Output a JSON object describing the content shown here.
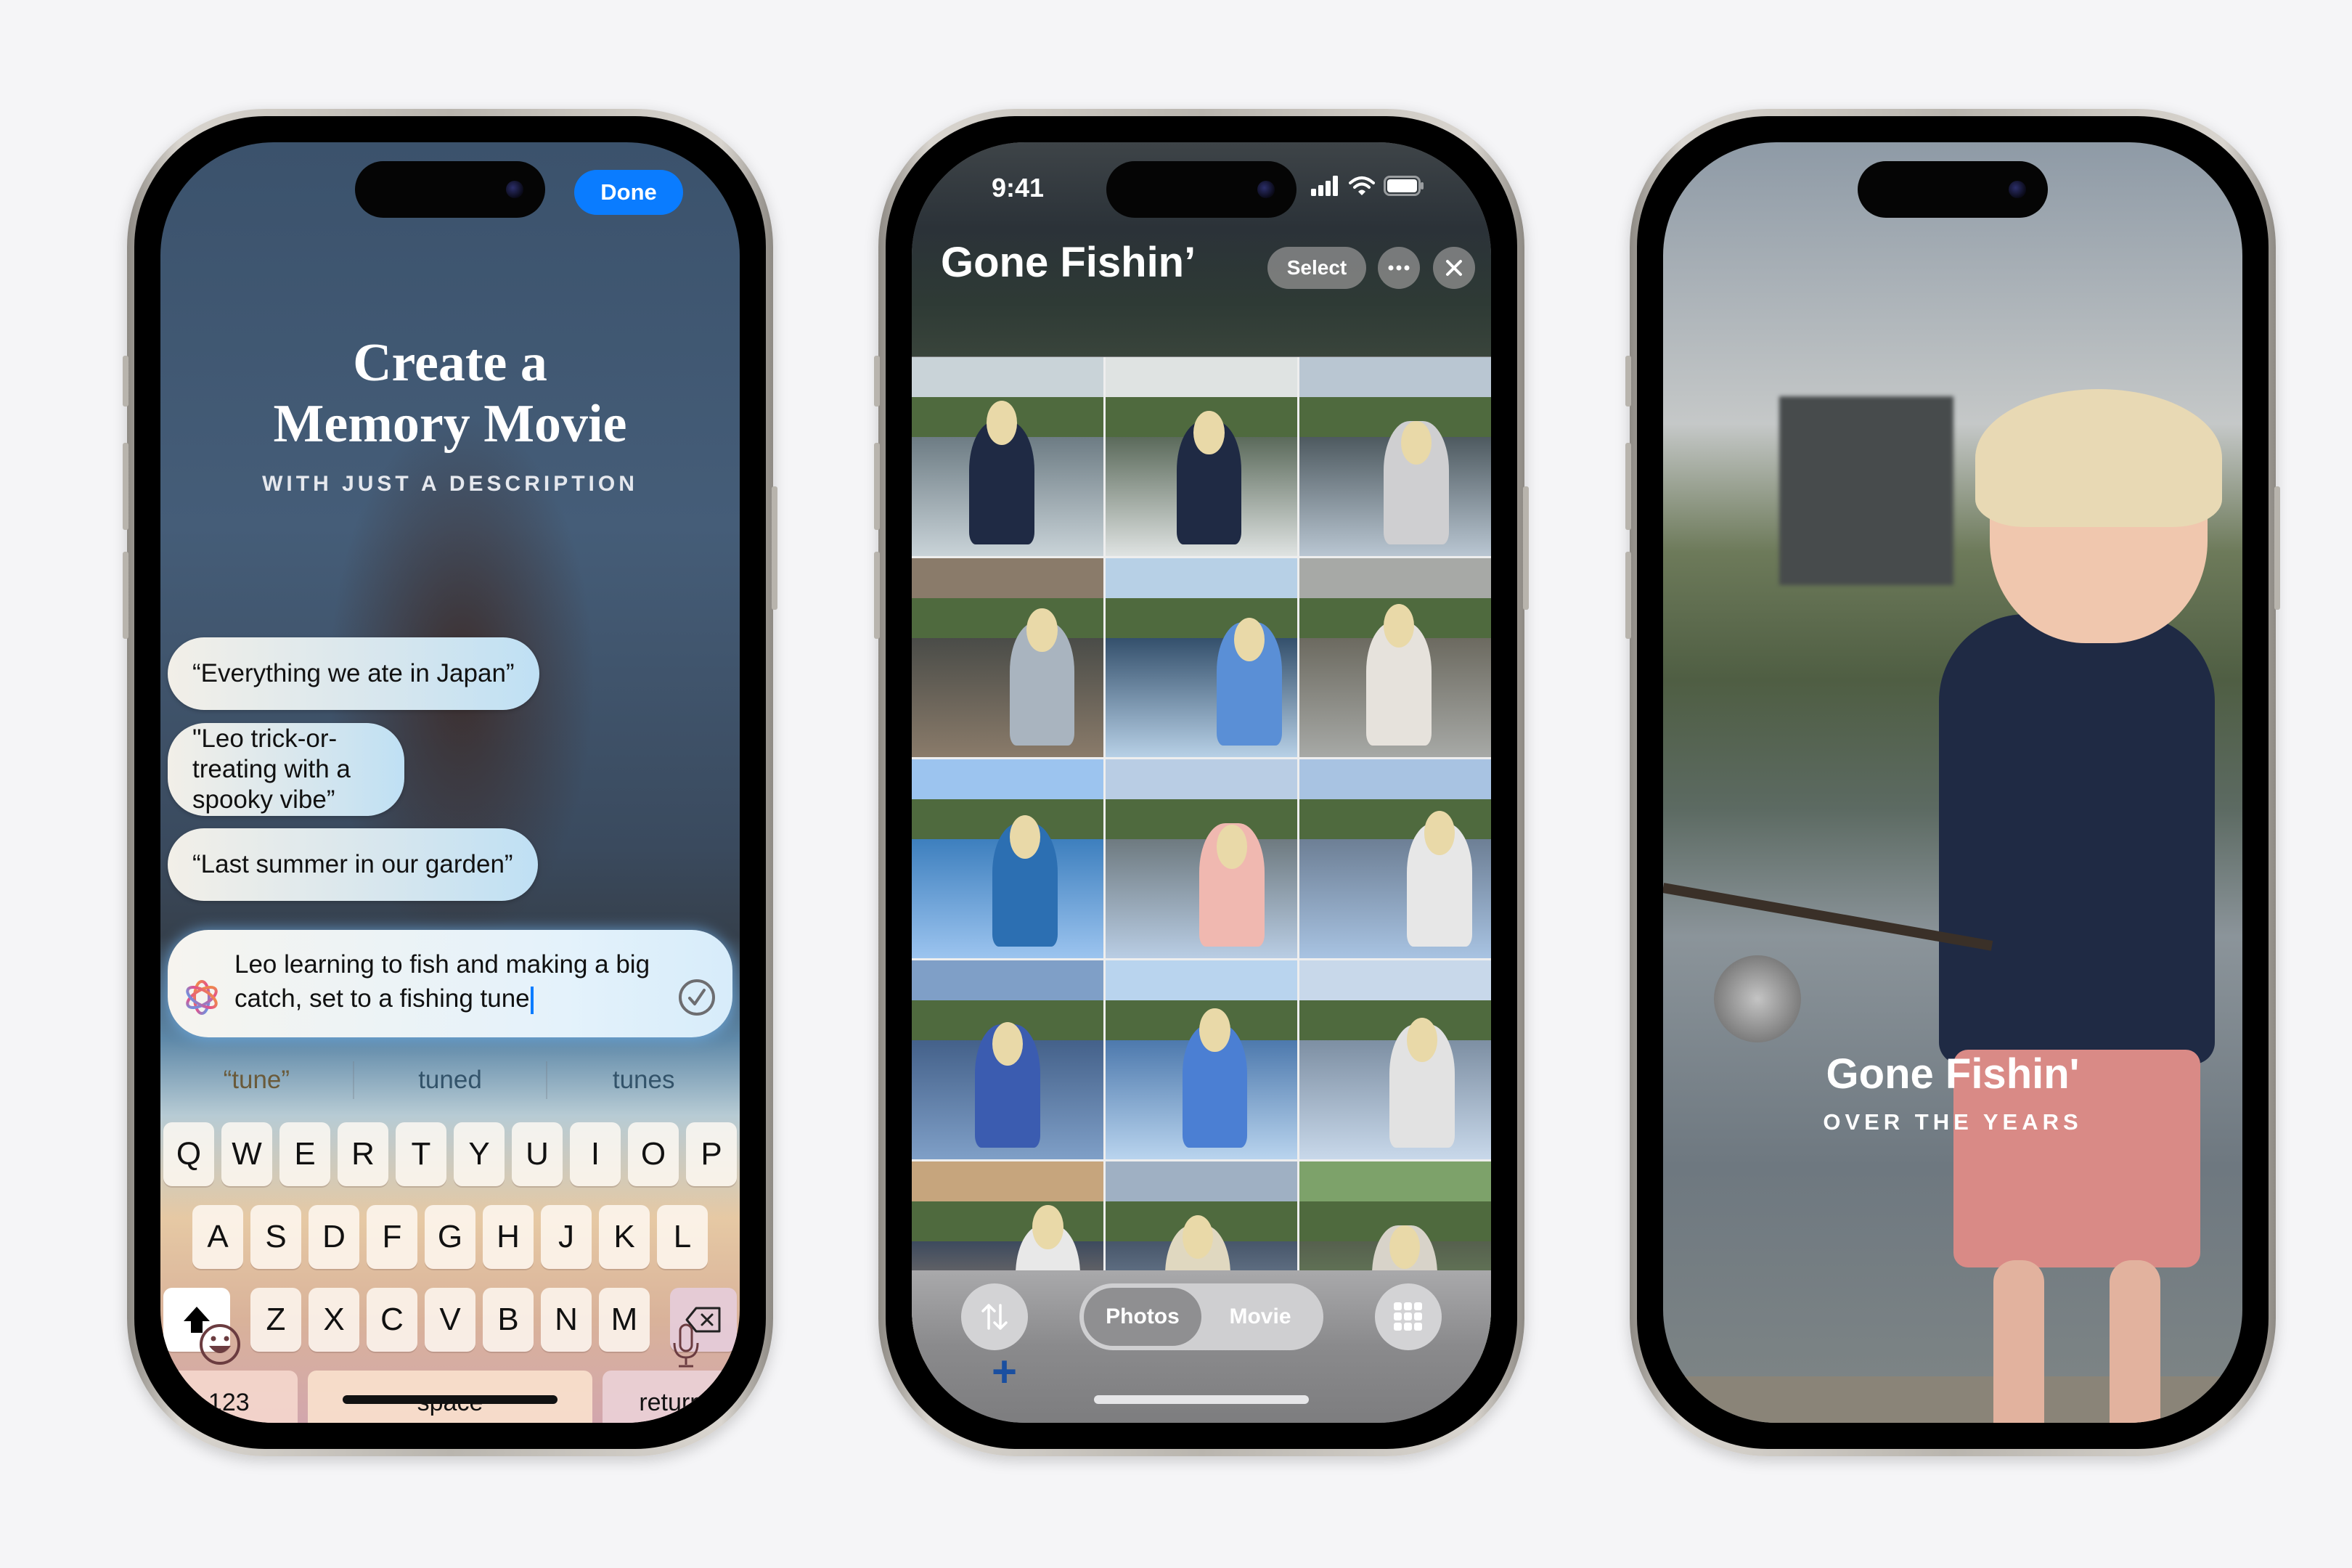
{
  "phone_left": {
    "done_button": "Done",
    "title_line1": "Create a",
    "title_line2": "Memory Movie",
    "subtitle": "WITH JUST A DESCRIPTION",
    "example_prompts": [
      "“Everything we ate in Japan”",
      "\"Leo trick-or-treating with a spooky vibe”",
      "“Last summer in our garden”"
    ],
    "prompt_input": {
      "value": "Leo learning to fish and making a big catch, set to a fishing tune",
      "icon": "apple-intelligence-icon",
      "submit_icon": "checkmark-circle-icon"
    },
    "suggestions": [
      "“tune”",
      "tuned",
      "tunes"
    ],
    "keyboard": {
      "row1": [
        "Q",
        "W",
        "E",
        "R",
        "T",
        "Y",
        "U",
        "I",
        "O",
        "P"
      ],
      "row2": [
        "A",
        "S",
        "D",
        "F",
        "G",
        "H",
        "J",
        "K",
        "L"
      ],
      "row3": [
        "Z",
        "X",
        "C",
        "V",
        "B",
        "N",
        "M"
      ],
      "numbers_key": "123",
      "space_key": "space",
      "return_key": "return",
      "shift_icon": "shift-icon",
      "delete_icon": "delete-icon",
      "emoji_icon": "emoji-icon",
      "mic_icon": "microphone-icon"
    }
  },
  "phone_middle": {
    "status_time": "9:41",
    "album_title": "Gone Fishin’",
    "select_button": "Select",
    "more_icon": "ellipsis-icon",
    "close_icon": "close-icon",
    "photo_count": 15,
    "segmented_control": [
      "Photos",
      "Movie"
    ],
    "segmented_selected": "Photos",
    "sort_icon": "sort-arrows-icon",
    "grid_icon": "grid-icon",
    "add_icon": "plus-icon",
    "accent_colors": {
      "plus": "#1a4fa0"
    }
  },
  "phone_right": {
    "movie_title": "Gone Fishin'",
    "movie_subtitle": "OVER THE YEARS"
  },
  "colors": {
    "done_blue": "#0a7cff",
    "background": "#f5f5f7"
  }
}
